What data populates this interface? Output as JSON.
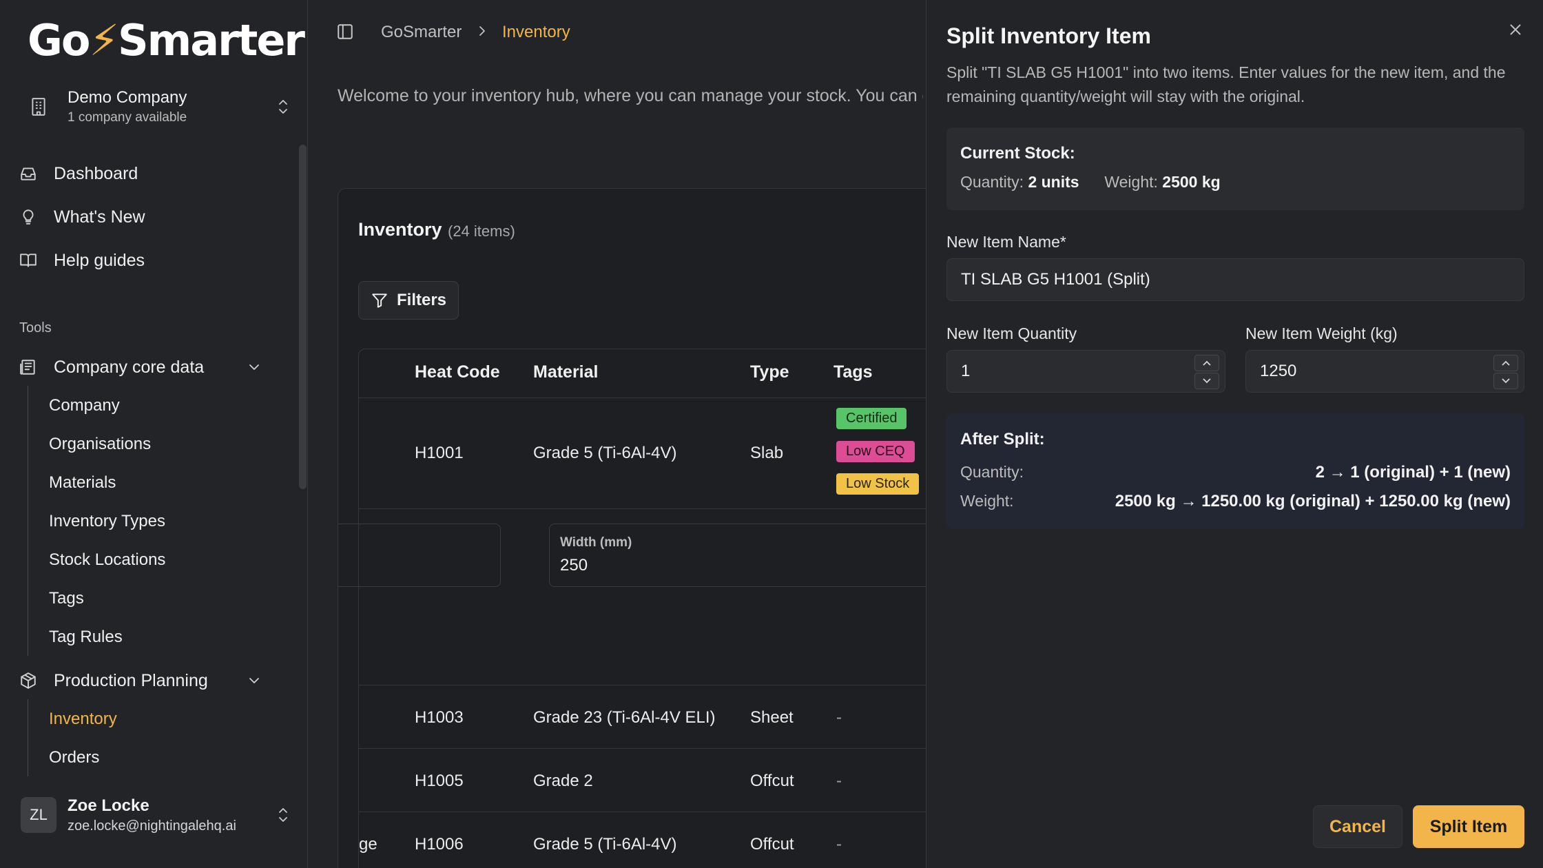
{
  "app": {
    "logo_text_a": "Go",
    "logo_bolt": "⚡",
    "logo_text_b": "Smarter"
  },
  "company": {
    "name": "Demo Company",
    "sub": "1 company available"
  },
  "nav": [
    {
      "label": "Dashboard",
      "icon": "inbox-icon"
    },
    {
      "label": "What's New",
      "icon": "lightbulb-icon"
    },
    {
      "label": "Help guides",
      "icon": "book-icon"
    }
  ],
  "tools_label": "Tools",
  "groups": {
    "core": {
      "label": "Company core data",
      "items": [
        "Company",
        "Organisations",
        "Materials",
        "Inventory Types",
        "Stock Locations",
        "Tags",
        "Tag Rules"
      ]
    },
    "planning": {
      "label": "Production Planning",
      "items": [
        "Inventory",
        "Orders"
      ]
    }
  },
  "user": {
    "initials": "ZL",
    "name": "Zoe Locke",
    "email": "zoe.locke@nightingalehq.ai"
  },
  "breadcrumb": {
    "root": "GoSmarter",
    "current": "Inventory"
  },
  "welcome": "Welcome to your inventory hub, where you can manage your stock. You can quickly",
  "inventory": {
    "title": "Inventory",
    "count": "(24 items)",
    "filters": "Filters",
    "columns": [
      "Heat Code",
      "Material",
      "Type",
      "Tags"
    ],
    "rows": [
      {
        "heat": "H1001",
        "material": "Grade 5 (Ti-6Al-4V)",
        "type": "Slab",
        "tags": [
          "Certified",
          "Low CEQ",
          "Low Stock"
        ]
      },
      {
        "heat": "H1003",
        "material": "Grade 23 (Ti-6Al-4V ELI)",
        "type": "Sheet",
        "tags_text": "-"
      },
      {
        "heat": "H1005",
        "material": "Grade 2",
        "type": "Offcut",
        "tags_text": "-"
      },
      {
        "heat": "H1006",
        "material": "Grade 5 (Ti-6Al-4V)",
        "type": "Offcut",
        "tags_text": "-",
        "lead": "ge"
      }
    ],
    "detail": {
      "width_label": "Width (mm)",
      "width_value": "250"
    }
  },
  "panel": {
    "title": "Split Inventory Item",
    "description": "Split \"TI SLAB G5 H1001\" into two items. Enter values for the new item, and the remaining quantity/weight will stay with the original.",
    "current_stock": {
      "heading": "Current Stock:",
      "quantity_label": "Quantity:",
      "quantity_value": "2 units",
      "weight_label": "Weight:",
      "weight_value": "2500 kg"
    },
    "name_label": "New Item Name*",
    "name_value": "TI SLAB G5 H1001 (Split)",
    "qty_label": "New Item Quantity",
    "qty_value": "1",
    "weight_label": "New Item Weight (kg)",
    "weight_value": "1250",
    "after": {
      "heading": "After Split:",
      "quantity_label": "Quantity:",
      "quantity_value": "2 → 1 (original) + 1 (new)",
      "weight_label": "Weight:",
      "weight_value": "2500 kg → 1250.00 kg (original) + 1250.00 kg (new)"
    },
    "cancel": "Cancel",
    "submit": "Split Item"
  },
  "colors": {
    "accent": "#f2b54a",
    "background": "#222427",
    "tag_certified": "#58c468",
    "tag_low_ceq": "#dc4c97",
    "tag_low_stock": "#f0c347"
  }
}
